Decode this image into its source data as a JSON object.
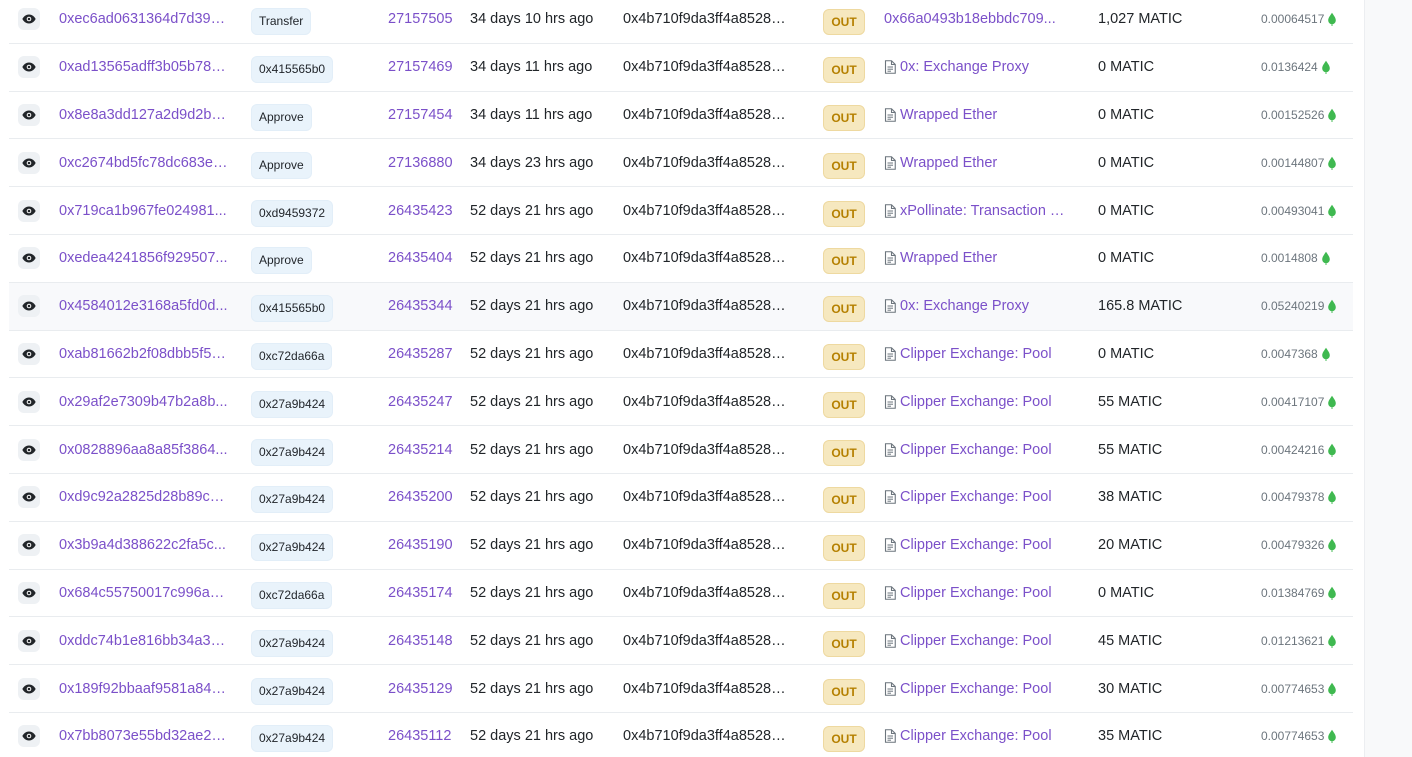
{
  "colors": {
    "link": "#7b50c9",
    "out_badge_bg": "#f6e8bf",
    "out_badge_text": "#b58000",
    "method_badge_bg": "#e9f3fb",
    "gas_icon": "#3fb950"
  },
  "icons": {
    "view": "eye-icon",
    "contract": "file-text-icon",
    "gas": "gas-drop-icon"
  },
  "rows": [
    {
      "hash": "0xec6ad0631364d7d39e...",
      "method": "Transfer",
      "block": "27157505",
      "age": "34 days 10 hrs ago",
      "from": "0x4b710f9da3ff4a85284...",
      "direction": "OUT",
      "to": "0x66a0493b18ebbdc709...",
      "to_is_contract": false,
      "value": "1,027 MATIC",
      "fee": "0.00064517"
    },
    {
      "hash": "0xad13565adff3b05b788...",
      "method": "0x415565b0",
      "block": "27157469",
      "age": "34 days 11 hrs ago",
      "from": "0x4b710f9da3ff4a85284...",
      "direction": "OUT",
      "to": "0x: Exchange Proxy",
      "to_is_contract": true,
      "value": "0 MATIC",
      "fee": "0.0136424"
    },
    {
      "hash": "0x8e8a3dd127a2d9d2b5...",
      "method": "Approve",
      "block": "27157454",
      "age": "34 days 11 hrs ago",
      "from": "0x4b710f9da3ff4a85284...",
      "direction": "OUT",
      "to": "Wrapped Ether",
      "to_is_contract": true,
      "value": "0 MATIC",
      "fee": "0.00152526"
    },
    {
      "hash": "0xc2674bd5fc78dc683e8...",
      "method": "Approve",
      "block": "27136880",
      "age": "34 days 23 hrs ago",
      "from": "0x4b710f9da3ff4a85284...",
      "direction": "OUT",
      "to": "Wrapped Ether",
      "to_is_contract": true,
      "value": "0 MATIC",
      "fee": "0.00144807"
    },
    {
      "hash": "0x719ca1b967fe024981...",
      "method": "0xd9459372",
      "block": "26435423",
      "age": "52 days 21 hrs ago",
      "from": "0x4b710f9da3ff4a85284...",
      "direction": "OUT",
      "to": "xPollinate: Transaction M...",
      "to_is_contract": true,
      "value": "0 MATIC",
      "fee": "0.00493041"
    },
    {
      "hash": "0xedea4241856f929507...",
      "method": "Approve",
      "block": "26435404",
      "age": "52 days 21 hrs ago",
      "from": "0x4b710f9da3ff4a85284...",
      "direction": "OUT",
      "to": "Wrapped Ether",
      "to_is_contract": true,
      "value": "0 MATIC",
      "fee": "0.0014808"
    },
    {
      "hash": "0x4584012e3168a5fd0d...",
      "method": "0x415565b0",
      "block": "26435344",
      "age": "52 days 21 hrs ago",
      "from": "0x4b710f9da3ff4a85284...",
      "direction": "OUT",
      "to": "0x: Exchange Proxy",
      "to_is_contract": true,
      "value": "165.8 MATIC",
      "fee": "0.05240219"
    },
    {
      "hash": "0xab81662b2f08dbb5f56...",
      "method": "0xc72da66a",
      "block": "26435287",
      "age": "52 days 21 hrs ago",
      "from": "0x4b710f9da3ff4a85284...",
      "direction": "OUT",
      "to": "Clipper Exchange: Pool",
      "to_is_contract": true,
      "value": "0 MATIC",
      "fee": "0.0047368"
    },
    {
      "hash": "0x29af2e7309b47b2a8b...",
      "method": "0x27a9b424",
      "block": "26435247",
      "age": "52 days 21 hrs ago",
      "from": "0x4b710f9da3ff4a85284...",
      "direction": "OUT",
      "to": "Clipper Exchange: Pool",
      "to_is_contract": true,
      "value": "55 MATIC",
      "fee": "0.00417107"
    },
    {
      "hash": "0x0828896aa8a85f3864...",
      "method": "0x27a9b424",
      "block": "26435214",
      "age": "52 days 21 hrs ago",
      "from": "0x4b710f9da3ff4a85284...",
      "direction": "OUT",
      "to": "Clipper Exchange: Pool",
      "to_is_contract": true,
      "value": "55 MATIC",
      "fee": "0.00424216"
    },
    {
      "hash": "0xd9c92a2825d28b89c4...",
      "method": "0x27a9b424",
      "block": "26435200",
      "age": "52 days 21 hrs ago",
      "from": "0x4b710f9da3ff4a85284...",
      "direction": "OUT",
      "to": "Clipper Exchange: Pool",
      "to_is_contract": true,
      "value": "38 MATIC",
      "fee": "0.00479378"
    },
    {
      "hash": "0x3b9a4d388622c2fa5c...",
      "method": "0x27a9b424",
      "block": "26435190",
      "age": "52 days 21 hrs ago",
      "from": "0x4b710f9da3ff4a85284...",
      "direction": "OUT",
      "to": "Clipper Exchange: Pool",
      "to_is_contract": true,
      "value": "20 MATIC",
      "fee": "0.00479326"
    },
    {
      "hash": "0x684c55750017c996aa...",
      "method": "0xc72da66a",
      "block": "26435174",
      "age": "52 days 21 hrs ago",
      "from": "0x4b710f9da3ff4a85284...",
      "direction": "OUT",
      "to": "Clipper Exchange: Pool",
      "to_is_contract": true,
      "value": "0 MATIC",
      "fee": "0.01384769"
    },
    {
      "hash": "0xddc74b1e816bb34a3b...",
      "method": "0x27a9b424",
      "block": "26435148",
      "age": "52 days 21 hrs ago",
      "from": "0x4b710f9da3ff4a85284...",
      "direction": "OUT",
      "to": "Clipper Exchange: Pool",
      "to_is_contract": true,
      "value": "45 MATIC",
      "fee": "0.01213621"
    },
    {
      "hash": "0x189f92bbaaf9581a84a...",
      "method": "0x27a9b424",
      "block": "26435129",
      "age": "52 days 21 hrs ago",
      "from": "0x4b710f9da3ff4a85284...",
      "direction": "OUT",
      "to": "Clipper Exchange: Pool",
      "to_is_contract": true,
      "value": "30 MATIC",
      "fee": "0.00774653"
    },
    {
      "hash": "0x7bb8073e55bd32ae22...",
      "method": "0x27a9b424",
      "block": "26435112",
      "age": "52 days 21 hrs ago",
      "from": "0x4b710f9da3ff4a85284...",
      "direction": "OUT",
      "to": "Clipper Exchange: Pool",
      "to_is_contract": true,
      "value": "35 MATIC",
      "fee": "0.00774653"
    }
  ]
}
